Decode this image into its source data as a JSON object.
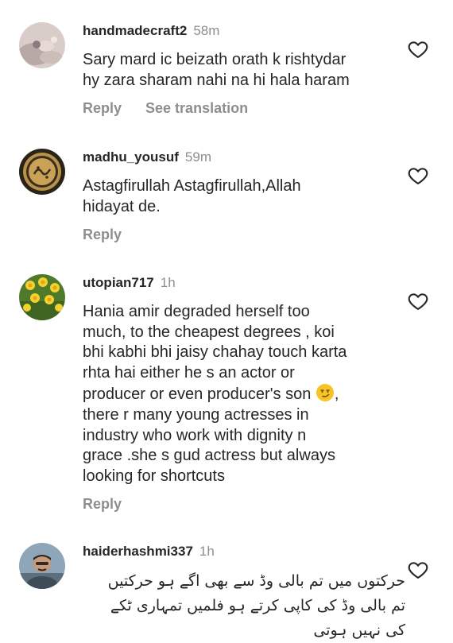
{
  "comments": [
    {
      "username": "handmadecraft2",
      "time": "58m",
      "lines": [
        "Sary mard ic beizath orath k rishtydar",
        "hy zara sharam nahi na hi hala haram"
      ],
      "reply": "Reply",
      "see_translation": "See translation"
    },
    {
      "username": "madhu_yousuf",
      "time": "59m",
      "lines": [
        "Astagfirullah Astagfirullah,Allah",
        "hidayat de."
      ],
      "reply": "Reply"
    },
    {
      "username": "utopian717",
      "time": "1h",
      "lines": [
        "Hania amir degraded herself too",
        "much,  to the cheapest degrees , koi",
        "bhi kabhi bhi jaisy chahay touch karta",
        "rhta hai either he s an actor or",
        "producer or even producer's  son",
        "there r many young actresses in",
        "industry who work with dignity n",
        "grace .she s gud actress but always",
        "looking for shortcuts"
      ],
      "emoji": "smirking-face",
      "reply": "Reply"
    },
    {
      "username": "haiderhashmi337",
      "time": "1h",
      "lines": [
        "حرکتوں میں تم بالی وڈ سے بھی اگے ہو حرکتیں",
        "تم بالی وڈ کی کاپی کرتے ہو فلمیں  تمہاری ٹکے",
        "کی نہیں ہوتی"
      ]
    }
  ],
  "icons": {
    "like": "heart-outline-icon"
  },
  "colors": {
    "text": "#262626",
    "muted": "#8e8e8e",
    "background": "#ffffff"
  }
}
